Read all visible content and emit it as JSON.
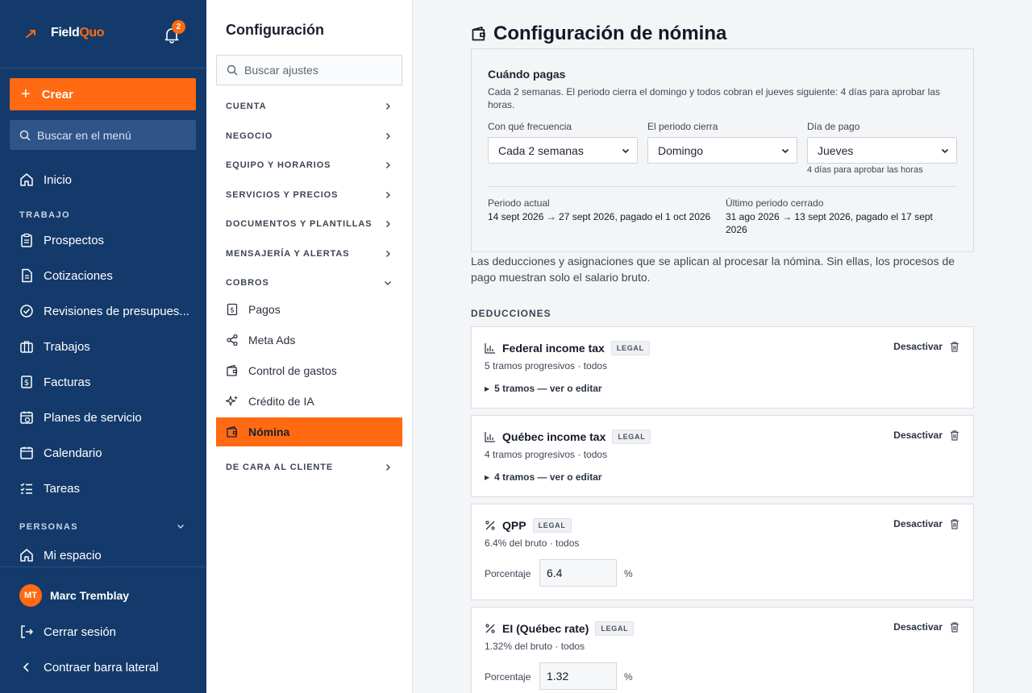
{
  "brand": {
    "name_part1": "Field",
    "name_part2": "Quo",
    "notifications": "2"
  },
  "sidebar": {
    "create_label": "Crear",
    "search_placeholder": "Buscar en el menú",
    "home": "Inicio",
    "section_work": "TRABAJO",
    "items": [
      "Prospectos",
      "Cotizaciones",
      "Revisiones de presupues...",
      "Trabajos",
      "Facturas",
      "Planes de servicio",
      "Calendario",
      "Tareas"
    ],
    "section_people": "PERSONAS",
    "my_space": "Mi espacio",
    "user_initials": "MT",
    "user_name": "Marc Tremblay",
    "logout": "Cerrar sesión",
    "collapse": "Contraer barra lateral"
  },
  "settings": {
    "title": "Configuración",
    "search_placeholder": "Buscar ajustes",
    "sections": [
      "CUENTA",
      "NEGOCIO",
      "EQUIPO Y HORARIOS",
      "SERVICIOS Y PRECIOS",
      "DOCUMENTOS Y PLANTILLAS",
      "MENSAJERÍA Y ALERTAS",
      "COBROS",
      "DE CARA AL CLIENTE"
    ],
    "cobros_items": [
      "Pagos",
      "Meta Ads",
      "Control de gastos",
      "Crédito de IA",
      "Nómina"
    ]
  },
  "main": {
    "title": "Configuración de nómina",
    "pay_schedule": {
      "title": "Cuándo pagas",
      "description": "Cada 2 semanas. El periodo cierra el domingo y todos cobran el jueves siguiente: 4 días para aprobar las horas.",
      "frequency_label": "Con qué frecuencia",
      "frequency_value": "Cada 2 semanas",
      "close_label": "El periodo cierra",
      "close_value": "Domingo",
      "payday_label": "Día de pago",
      "payday_value": "Jueves",
      "payday_hint": "4 días para aprobar las horas",
      "current_label": "Periodo actual",
      "current_value": "14 sept 2026 → 27 sept 2026, pagado el 1 oct 2026",
      "last_label": "Último periodo cerrado",
      "last_value": "31 ago 2026 → 13 sept 2026, pagado el 17 sept 2026"
    },
    "intro": "Las deducciones y asignaciones que se aplican al procesar la nómina. Sin ellas, los procesos de pago muestran solo el salario bruto.",
    "deductions_heading": "DEDUCCIONES",
    "action_label": "Desactivar",
    "deductions": [
      {
        "name": "Federal income tax",
        "badge": "LEGAL",
        "sub": "5 tramos progresivos · todos",
        "toggle": "5 tramos — ver o editar",
        "icon": "chart-icon"
      },
      {
        "name": "Québec income tax",
        "badge": "LEGAL",
        "sub": "4 tramos progresivos · todos",
        "toggle": "4 tramos — ver o editar",
        "icon": "chart-icon"
      },
      {
        "name": "QPP",
        "badge": "LEGAL",
        "sub": "6.4% del bruto · todos",
        "pct_label": "Porcentaje",
        "pct_value": "6.4",
        "unit": "%",
        "icon": "percent-icon"
      },
      {
        "name": "EI (Québec rate)",
        "badge": "LEGAL",
        "sub": "1.32% del bruto · todos",
        "pct_label": "Porcentaje",
        "pct_value": "1.32",
        "unit": "%",
        "icon": "percent-icon"
      }
    ]
  }
}
